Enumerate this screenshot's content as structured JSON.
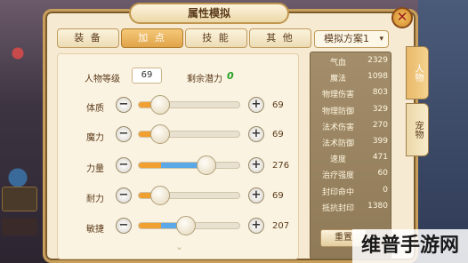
{
  "window": {
    "title": "属性模拟",
    "close_label": "✕"
  },
  "tabs": [
    {
      "label": "装 备",
      "active": false
    },
    {
      "label": "加 点",
      "active": true
    },
    {
      "label": "技 能",
      "active": false
    },
    {
      "label": "其 他",
      "active": false
    }
  ],
  "scheme": {
    "selected": "模拟方案1",
    "caret": "▾"
  },
  "level": {
    "label": "人物等级",
    "value": "69"
  },
  "remain": {
    "label": "剩余潜力",
    "value": "0"
  },
  "attributes": [
    {
      "label": "体质",
      "value": "69",
      "minus": "−",
      "plus": "+",
      "base_fraction": 0.22,
      "extra_fraction": 0.0
    },
    {
      "label": "魔力",
      "value": "69",
      "minus": "−",
      "plus": "+",
      "base_fraction": 0.22,
      "extra_fraction": 0.0
    },
    {
      "label": "力量",
      "value": "276",
      "minus": "−",
      "plus": "+",
      "base_fraction": 0.22,
      "extra_fraction": 0.45
    },
    {
      "label": "耐力",
      "value": "69",
      "minus": "−",
      "plus": "+",
      "base_fraction": 0.22,
      "extra_fraction": 0.0
    },
    {
      "label": "敏捷",
      "value": "207",
      "minus": "−",
      "plus": "+",
      "base_fraction": 0.22,
      "extra_fraction": 0.25
    }
  ],
  "scroll_hint": "⌄",
  "stats": [
    {
      "label": "气血",
      "value": "2329"
    },
    {
      "label": "魔法",
      "value": "1098"
    },
    {
      "label": "物理伤害",
      "value": "803"
    },
    {
      "label": "物理防御",
      "value": "329"
    },
    {
      "label": "法术伤害",
      "value": "270"
    },
    {
      "label": "法术防御",
      "value": "399"
    },
    {
      "label": "速度",
      "value": "471"
    },
    {
      "label": "治疗强度",
      "value": "60"
    },
    {
      "label": "封印命中",
      "value": "0"
    },
    {
      "label": "抵抗封印",
      "value": "1380"
    }
  ],
  "reset_label": "重置",
  "side_tabs": [
    {
      "label": "人物",
      "active": true
    },
    {
      "label": "宠物",
      "active": false
    }
  ],
  "watermark": "维普手游网",
  "colors": {
    "accent": "#e1a44a",
    "bar_base": "#f0a030",
    "bar_fill": "#5aa8e8",
    "remain": "#28a028"
  }
}
